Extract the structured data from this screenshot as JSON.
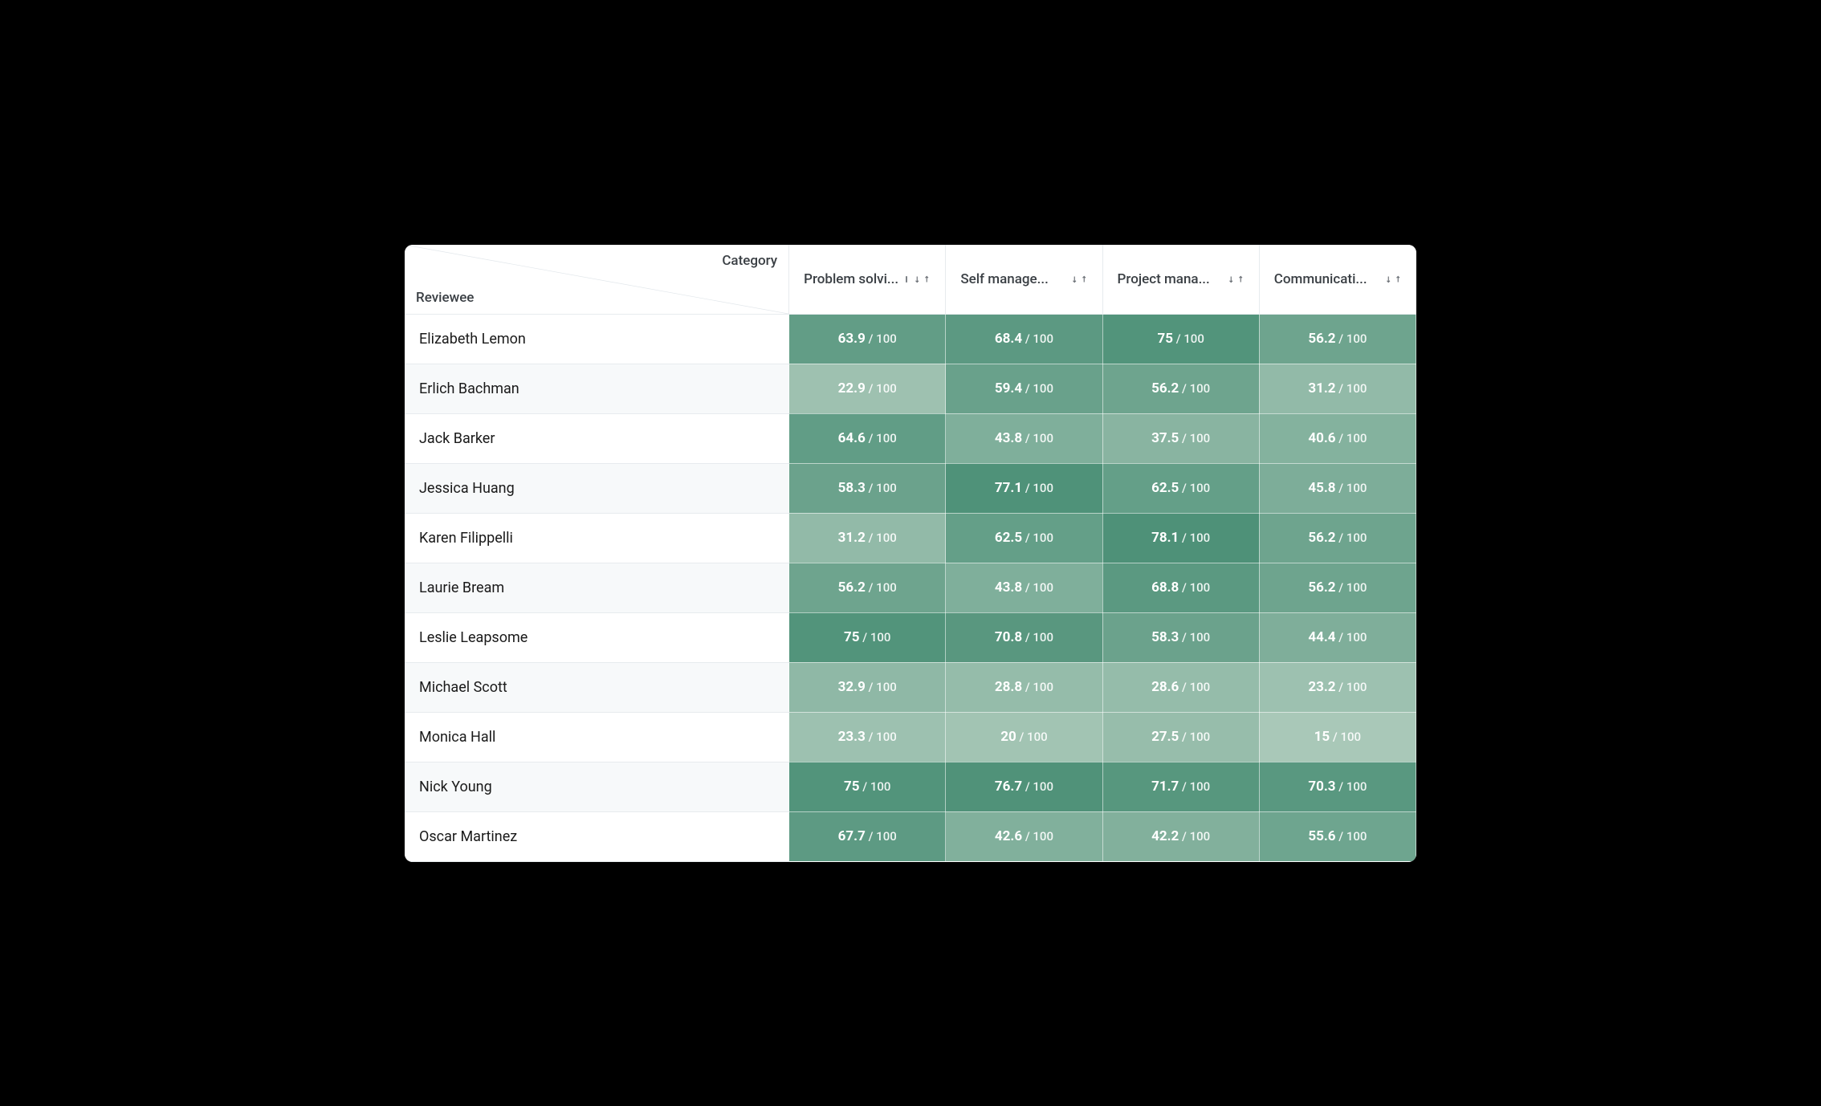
{
  "header": {
    "corner_top": "Category",
    "corner_bottom": "Reviewee",
    "columns": [
      {
        "label": "Problem solvi..."
      },
      {
        "label": "Self manage..."
      },
      {
        "label": "Project mana..."
      },
      {
        "label": "Communicati..."
      }
    ]
  },
  "denominator_prefix": " / ",
  "denominator": "100",
  "rows": [
    {
      "name": "Elizabeth Lemon",
      "scores": [
        63.9,
        68.4,
        75,
        56.2
      ]
    },
    {
      "name": "Erlich Bachman",
      "scores": [
        22.9,
        59.4,
        56.2,
        31.2
      ]
    },
    {
      "name": "Jack Barker",
      "scores": [
        64.6,
        43.8,
        37.5,
        40.6
      ]
    },
    {
      "name": "Jessica Huang",
      "scores": [
        58.3,
        77.1,
        62.5,
        45.8
      ]
    },
    {
      "name": "Karen Filippelli",
      "scores": [
        31.2,
        62.5,
        78.1,
        56.2
      ]
    },
    {
      "name": "Laurie Bream",
      "scores": [
        56.2,
        43.8,
        68.8,
        56.2
      ]
    },
    {
      "name": "Leslie Leapsome",
      "scores": [
        75,
        70.8,
        58.3,
        44.4
      ]
    },
    {
      "name": "Michael Scott",
      "scores": [
        32.9,
        28.8,
        28.6,
        23.2
      ]
    },
    {
      "name": "Monica Hall",
      "scores": [
        23.3,
        20,
        27.5,
        15
      ]
    },
    {
      "name": "Nick Young",
      "scores": [
        75,
        76.7,
        71.7,
        70.3
      ]
    },
    {
      "name": "Oscar Martinez",
      "scores": [
        67.7,
        42.6,
        42.2,
        55.6
      ]
    }
  ],
  "heatmap": {
    "min": 15,
    "max": 78.1,
    "lowColor": "#a9c8b8",
    "highColor": "#4e9178"
  }
}
